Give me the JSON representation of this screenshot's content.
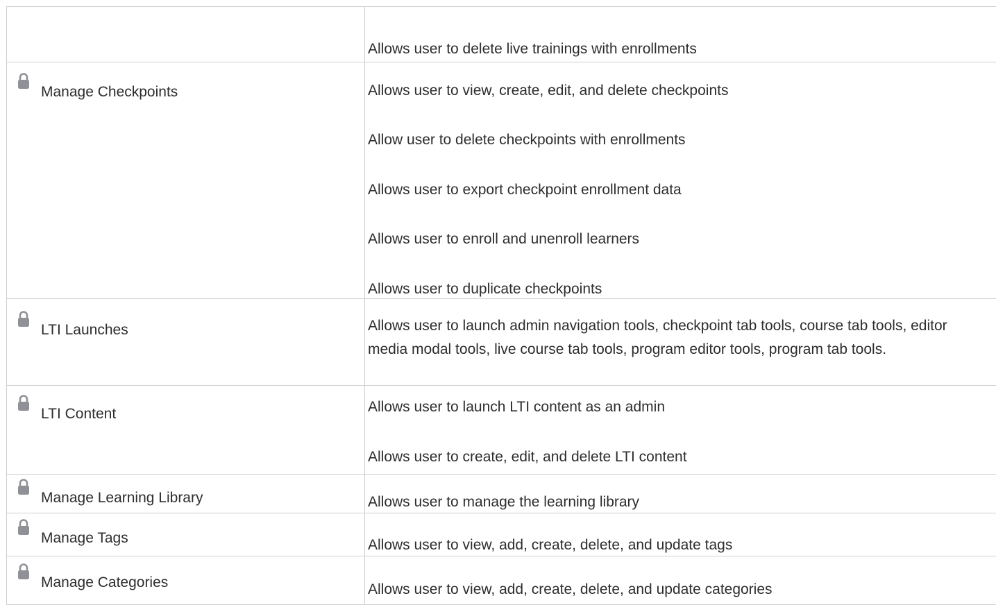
{
  "rows": [
    {
      "name": "",
      "locked": false,
      "descriptions": [
        "Allows user to delete live trainings with enrollments"
      ]
    },
    {
      "name": "Manage Checkpoints",
      "locked": true,
      "descriptions": [
        "Allows user to view, create, edit, and delete checkpoints",
        "Allow user to delete checkpoints with enrollments",
        "Allows user to export checkpoint enrollment data",
        "Allows user to enroll and unenroll learners",
        "Allows user to duplicate checkpoints"
      ]
    },
    {
      "name": "LTI Launches",
      "locked": true,
      "descriptions": [
        "Allows user to launch admin navigation tools, checkpoint tab tools, course tab tools, editor media modal tools, live course tab tools, program editor tools, program tab tools."
      ]
    },
    {
      "name": "LTI Content",
      "locked": true,
      "descriptions": [
        "Allows user to launch LTI content as an admin",
        "Allows user to create, edit, and delete LTI content"
      ]
    },
    {
      "name": "Manage Learning Library",
      "locked": true,
      "descriptions": [
        "Allows user to manage the learning library"
      ]
    },
    {
      "name": "Manage Tags",
      "locked": true,
      "descriptions": [
        "Allows user to view, add, create, delete, and update tags"
      ]
    },
    {
      "name": "Manage Categories",
      "locked": true,
      "descriptions": [
        "Allows user to view, add, create, delete, and update categories"
      ]
    }
  ],
  "icons": {
    "lock": "lock-icon"
  },
  "colors": {
    "text": "#2d2d2d",
    "border": "#cfcfcf",
    "lock": "#8f9196"
  }
}
